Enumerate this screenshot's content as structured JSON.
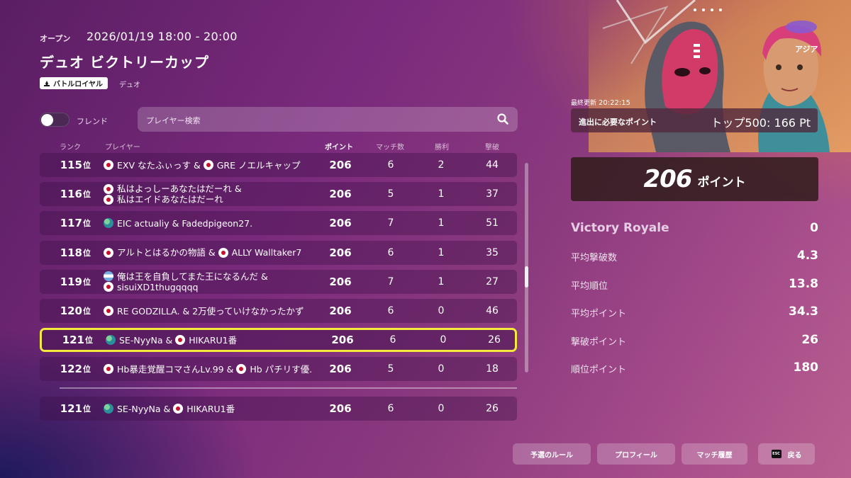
{
  "header": {
    "status": "オープン",
    "datetime": "2026/01/19 18:00 - 20:00",
    "title": "デュオ ビクトリーカップ",
    "mode_badge": "バトルロイヤル",
    "mode_sub": "デュオ"
  },
  "filters": {
    "friend_label": "フレンド",
    "friend_toggle_on": false,
    "search_placeholder": "プレイヤー検索"
  },
  "columns": {
    "rank": "ランク",
    "player": "プレイヤー",
    "points": "ポイント",
    "matches": "マッチ数",
    "wins": "勝利",
    "eliminations": "撃破"
  },
  "rank_suffix": "位",
  "rows": [
    {
      "rank": "115",
      "p1_flag": "jp",
      "p1": "EXV なたふぃっす",
      "p2_flag": "jp",
      "p2": "GRE ノエルキャップ",
      "points": "206",
      "matches": "6",
      "wins": "2",
      "elims": "44"
    },
    {
      "rank": "116",
      "p1_flag": "jp",
      "p1": "私はよっしーあなたはだーれ",
      "p2_flag": "jp",
      "p2": "私はエイドあなたはだーれ",
      "points": "206",
      "matches": "5",
      "wins": "1",
      "elims": "37"
    },
    {
      "rank": "117",
      "p1_flag": "globe",
      "p1": "EIC actualiy",
      "p2_flag": "",
      "p2": "Fadedpigeon27.",
      "points": "206",
      "matches": "7",
      "wins": "1",
      "elims": "51"
    },
    {
      "rank": "118",
      "p1_flag": "jp",
      "p1": "アルトとはるかの物語",
      "p2_flag": "jp",
      "p2": "ALLY Walltaker7",
      "points": "206",
      "matches": "6",
      "wins": "1",
      "elims": "35"
    },
    {
      "rank": "119",
      "p1_flag": "ar",
      "p1": "俺は王を自負してまた王になるんだ",
      "p2_flag": "jp",
      "p2": "sisuiXD1thugqqqq",
      "points": "206",
      "matches": "7",
      "wins": "1",
      "elims": "27"
    },
    {
      "rank": "120",
      "p1_flag": "jp",
      "p1": "RE GODZILLA.",
      "p2_flag": "",
      "p2": "2万使っていけなかったかず",
      "points": "206",
      "matches": "6",
      "wins": "0",
      "elims": "46"
    },
    {
      "rank": "121",
      "p1_flag": "globe",
      "p1": "SE-NyyNa",
      "p2_flag": "jp",
      "p2": "HIKARU1番",
      "points": "206",
      "matches": "6",
      "wins": "0",
      "elims": "26"
    },
    {
      "rank": "122",
      "p1_flag": "jp",
      "p1": "Hb暴走覚醒コマさんLv.99",
      "p2_flag": "jp",
      "p2": "Hb パチリす優.",
      "points": "206",
      "matches": "5",
      "wins": "0",
      "elims": "18"
    }
  ],
  "my_row": {
    "rank": "121",
    "p1_flag": "globe",
    "p1": "SE-NyyNa",
    "p2_flag": "jp",
    "p2": "HIKARU1番",
    "points": "206",
    "matches": "6",
    "wins": "0",
    "elims": "26"
  },
  "scroll_position": 0.55,
  "panel": {
    "region": "アジア",
    "updated_label": "最終更新",
    "updated_time": "20:22:15",
    "required_label": "進出に必要なポイント",
    "required_value": "トップ500: 166 Pt",
    "total_points": "206",
    "total_unit": "ポイント",
    "stats": [
      {
        "label": "Victory Royale",
        "value": "0"
      },
      {
        "label": "平均撃破数",
        "value": "4.3"
      },
      {
        "label": "平均順位",
        "value": "13.8"
      },
      {
        "label": "平均ポイント",
        "value": "34.3"
      },
      {
        "label": "撃破ポイント",
        "value": "26"
      },
      {
        "label": "順位ポイント",
        "value": "180"
      }
    ]
  },
  "buttons": {
    "rules": "予選のルール",
    "profile": "プロフィール",
    "history": "マッチ履歴",
    "back_key": "ESC",
    "back": "戻る"
  },
  "colors": {
    "highlight_border": "#f3ea3c",
    "japan_red": "#c8102e"
  },
  "icons": [
    "search-icon",
    "battle-royale-icon",
    "jp-flag-icon",
    "globe-flag-icon",
    "ar-flag-icon"
  ]
}
